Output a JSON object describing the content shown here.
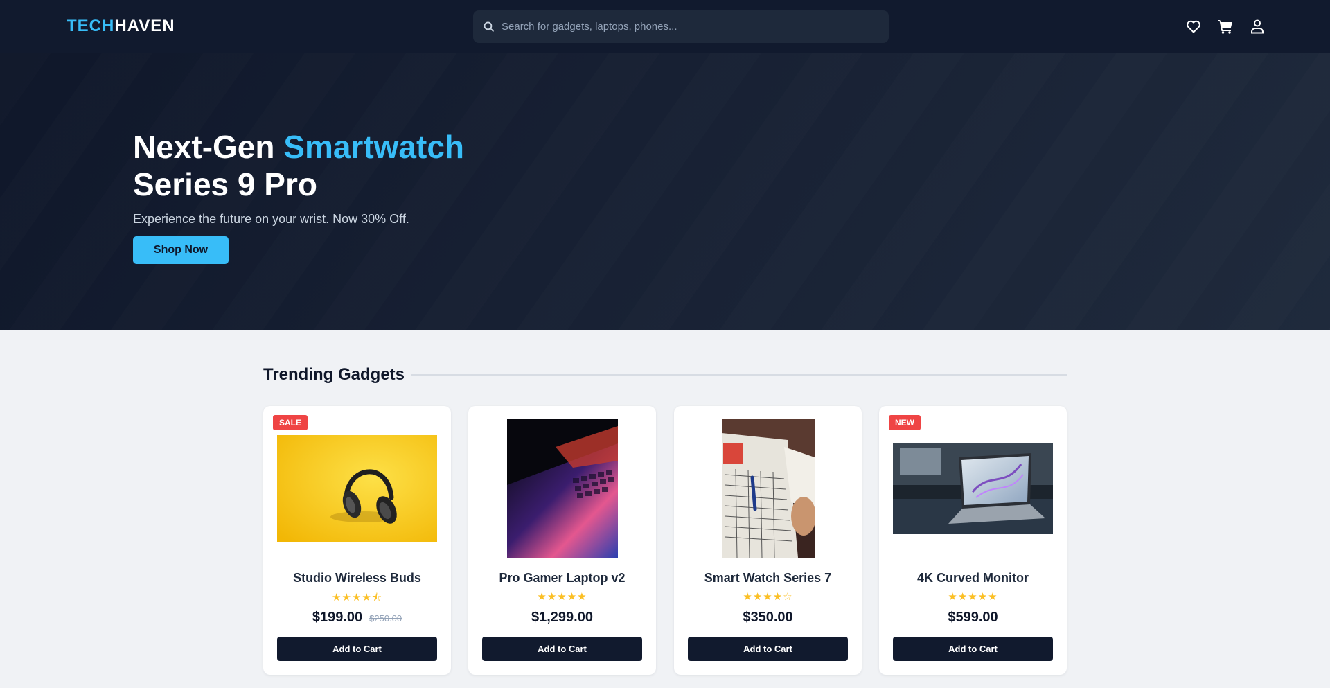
{
  "brand": {
    "part1": "TECH",
    "part2": "HAVEN",
    "accent": "#38bdf8"
  },
  "search": {
    "placeholder": "Search for gadgets, laptops, phones...",
    "value": ""
  },
  "header_icons": [
    "heart-icon",
    "cart-icon",
    "user-icon"
  ],
  "hero": {
    "title_start": "Next-Gen ",
    "title_highlight": "Smartwatch",
    "title_line2": "Series 9 Pro",
    "subtitle": "Experience the future on your wrist. Now 30% Off.",
    "button": "Shop Now"
  },
  "section": {
    "title": "Trending Gadgets"
  },
  "products": [
    {
      "badge": "SALE",
      "name": "Studio Wireless Buds",
      "rating": 4.5,
      "stars": "★★★★⯪",
      "price": "$199.00",
      "old_price": "$250.00",
      "button": "Add to Cart"
    },
    {
      "badge": "",
      "name": "Pro Gamer Laptop v2",
      "rating": 5,
      "stars": "★★★★★",
      "price": "$1,299.00",
      "old_price": "",
      "button": "Add to Cart"
    },
    {
      "badge": "",
      "name": "Smart Watch Series 7",
      "rating": 4,
      "stars": "★★★★☆",
      "price": "$350.00",
      "old_price": "",
      "button": "Add to Cart"
    },
    {
      "badge": "NEW",
      "name": "4K Curved Monitor",
      "rating": 5,
      "stars": "★★★★★",
      "price": "$599.00",
      "old_price": "",
      "button": "Add to Cart"
    }
  ],
  "colors": {
    "header_bg": "#111a2e",
    "accent": "#38bdf8",
    "badge": "#ef4444",
    "star": "#fbbf24",
    "button_dark": "#111a2e"
  }
}
